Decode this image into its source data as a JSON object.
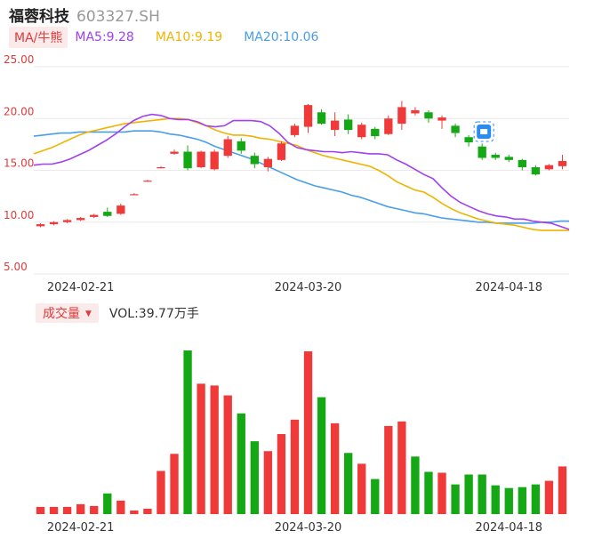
{
  "header": {
    "stock_name": "福蓉科技",
    "stock_code": "603327.SH"
  },
  "ma_bar": {
    "toggle_label": "MA/牛熊",
    "ma5_label": "MA5:9.28",
    "ma10_label": "MA10:9.19",
    "ma20_label": "MA20:10.06",
    "ma5_color": "#a040f0",
    "ma10_color": "#f0b400",
    "ma20_color": "#4a9ee8"
  },
  "volume_bar": {
    "toggle_label": "成交量",
    "value_label": "VOL:39.77万手"
  },
  "colors": {
    "up": "#f03a3a",
    "down": "#14a814",
    "axis_text": "#e03a3a",
    "grid": "#e9e9e9"
  },
  "chart_data": [
    {
      "type": "candlestick",
      "ylim": [
        5,
        25
      ],
      "y_ticks": [
        "25.00",
        "20.00",
        "15.00",
        "10.00",
        "5.00"
      ],
      "y_tick_values": [
        25,
        20,
        15,
        10,
        5
      ],
      "x_tick_labels": [
        "2024-02-21",
        "2024-03-20",
        "2024-04-18"
      ],
      "x_tick_indices": [
        3,
        20,
        35
      ],
      "candles": [
        {
          "o": 9.6,
          "c": 9.8,
          "h": 9.9,
          "l": 9.5
        },
        {
          "o": 9.8,
          "c": 10.0,
          "h": 10.1,
          "l": 9.7
        },
        {
          "o": 10.0,
          "c": 10.2,
          "h": 10.3,
          "l": 9.9
        },
        {
          "o": 10.2,
          "c": 10.4,
          "h": 10.5,
          "l": 10.1
        },
        {
          "o": 10.5,
          "c": 10.7,
          "h": 10.8,
          "l": 10.4
        },
        {
          "o": 11.0,
          "c": 10.6,
          "h": 11.4,
          "l": 10.5
        },
        {
          "o": 10.8,
          "c": 11.6,
          "h": 11.8,
          "l": 10.7
        },
        {
          "o": 12.6,
          "c": 12.7,
          "h": 12.8,
          "l": 12.6
        },
        {
          "o": 13.9,
          "c": 14.0,
          "h": 14.1,
          "l": 13.9
        },
        {
          "o": 15.2,
          "c": 15.3,
          "h": 15.4,
          "l": 15.2
        },
        {
          "o": 16.6,
          "c": 16.8,
          "h": 17.0,
          "l": 16.5
        },
        {
          "o": 16.8,
          "c": 15.2,
          "h": 17.4,
          "l": 15.0
        },
        {
          "o": 15.3,
          "c": 16.8,
          "h": 16.9,
          "l": 15.2
        },
        {
          "o": 15.1,
          "c": 16.8,
          "h": 17.0,
          "l": 15.0
        },
        {
          "o": 16.4,
          "c": 18.0,
          "h": 18.3,
          "l": 16.2
        },
        {
          "o": 17.8,
          "c": 16.9,
          "h": 18.1,
          "l": 16.6
        },
        {
          "o": 16.4,
          "c": 15.6,
          "h": 16.7,
          "l": 15.2
        },
        {
          "o": 15.3,
          "c": 16.1,
          "h": 16.3,
          "l": 14.9
        },
        {
          "o": 16.0,
          "c": 17.6,
          "h": 17.8,
          "l": 15.9
        },
        {
          "o": 18.4,
          "c": 19.3,
          "h": 19.5,
          "l": 18.2
        },
        {
          "o": 19.2,
          "c": 21.3,
          "h": 21.4,
          "l": 18.6
        },
        {
          "o": 20.6,
          "c": 19.5,
          "h": 20.9,
          "l": 19.4
        },
        {
          "o": 18.9,
          "c": 19.8,
          "h": 20.6,
          "l": 18.3
        },
        {
          "o": 19.9,
          "c": 18.9,
          "h": 20.4,
          "l": 18.5
        },
        {
          "o": 18.2,
          "c": 19.4,
          "h": 19.6,
          "l": 18.0
        },
        {
          "o": 19.0,
          "c": 18.3,
          "h": 19.2,
          "l": 18.0
        },
        {
          "o": 18.5,
          "c": 20.0,
          "h": 20.3,
          "l": 18.4
        },
        {
          "o": 19.5,
          "c": 21.1,
          "h": 21.7,
          "l": 18.9
        },
        {
          "o": 20.5,
          "c": 20.8,
          "h": 21.1,
          "l": 20.3
        },
        {
          "o": 20.6,
          "c": 20.0,
          "h": 20.8,
          "l": 19.6
        },
        {
          "o": 19.8,
          "c": 20.1,
          "h": 20.3,
          "l": 19.0
        },
        {
          "o": 19.3,
          "c": 18.6,
          "h": 19.5,
          "l": 18.2
        },
        {
          "o": 18.2,
          "c": 17.7,
          "h": 18.4,
          "l": 17.3
        },
        {
          "o": 17.3,
          "c": 16.2,
          "h": 17.6,
          "l": 16.0
        },
        {
          "o": 16.5,
          "c": 16.2,
          "h": 16.7,
          "l": 16.0
        },
        {
          "o": 16.3,
          "c": 16.0,
          "h": 16.5,
          "l": 15.8
        },
        {
          "o": 16.0,
          "c": 15.3,
          "h": 16.1,
          "l": 15.0
        },
        {
          "o": 15.3,
          "c": 14.6,
          "h": 15.5,
          "l": 14.5
        },
        {
          "o": 15.1,
          "c": 15.5,
          "h": 15.6,
          "l": 15.0
        },
        {
          "o": 15.4,
          "c": 15.9,
          "h": 16.5,
          "l": 15.1
        }
      ],
      "ma5": [
        15.5,
        15.6,
        15.6,
        15.8,
        16.1,
        16.5,
        16.9,
        17.4,
        17.9,
        18.5,
        19.2,
        19.8,
        20.2,
        20.4,
        20.3,
        20.0,
        19.9,
        19.9,
        19.7,
        19.3,
        19.2,
        19.3,
        19.8,
        19.8,
        19.8,
        19.7,
        19.3,
        18.6,
        17.7,
        17.2,
        17.0,
        16.9,
        16.8,
        16.8,
        16.7,
        16.8,
        16.7,
        16.6,
        16.6,
        16.5,
        16.0,
        15.6,
        15.1,
        14.6,
        14.2,
        13.3,
        12.5,
        11.9,
        11.5,
        11.1,
        10.8,
        10.6,
        10.5,
        10.3,
        10.3,
        10.1,
        10.0,
        9.9,
        9.6,
        9.3
      ],
      "ma10": [
        16.6,
        16.9,
        17.2,
        17.6,
        18.0,
        18.4,
        18.7,
        18.9,
        19.1,
        19.3,
        19.5,
        19.6,
        19.7,
        19.8,
        19.9,
        20.0,
        20.0,
        19.9,
        19.6,
        19.3,
        18.9,
        18.6,
        18.4,
        18.4,
        18.3,
        18.1,
        18.0,
        17.8,
        17.6,
        17.4,
        17.0,
        16.7,
        16.4,
        16.2,
        16.0,
        15.8,
        15.6,
        15.4,
        15.0,
        14.5,
        13.9,
        13.5,
        13.1,
        12.9,
        12.4,
        11.8,
        11.3,
        10.9,
        10.6,
        10.3,
        10.1,
        9.9,
        9.8,
        9.7,
        9.5,
        9.3,
        9.2,
        9.2,
        9.2,
        9.2
      ],
      "ma20": [
        18.3,
        18.4,
        18.5,
        18.6,
        18.6,
        18.7,
        18.7,
        18.7,
        18.7,
        18.7,
        18.7,
        18.8,
        18.8,
        18.8,
        18.7,
        18.5,
        18.4,
        18.2,
        18.0,
        17.7,
        17.3,
        17.0,
        16.7,
        16.4,
        16.1,
        15.7,
        15.3,
        14.9,
        14.5,
        14.1,
        13.8,
        13.5,
        13.3,
        13.1,
        12.9,
        12.6,
        12.4,
        12.1,
        11.8,
        11.5,
        11.3,
        11.1,
        10.9,
        10.8,
        10.6,
        10.4,
        10.3,
        10.2,
        10.1,
        10.0,
        10.0,
        9.9,
        9.9,
        9.9,
        9.9,
        9.9,
        10.0,
        10.0,
        10.1,
        10.1
      ]
    },
    {
      "type": "bar",
      "series_name": "成交量",
      "x_tick_labels": [
        "2024-02-21",
        "2024-03-20",
        "2024-04-18"
      ],
      "x_tick_indices": [
        3,
        20,
        35
      ],
      "values": [
        8,
        8,
        8,
        11,
        9,
        23,
        15,
        4,
        6,
        48,
        67,
        182,
        145,
        143,
        132,
        112,
        81,
        70,
        89,
        105,
        181,
        130,
        101,
        68,
        56,
        39,
        98,
        103,
        64,
        47,
        46,
        33,
        44,
        44,
        32,
        29,
        30,
        33,
        37,
        53
      ],
      "up_flags": [
        1,
        1,
        1,
        1,
        1,
        0,
        1,
        1,
        1,
        1,
        1,
        0,
        1,
        1,
        1,
        0,
        0,
        1,
        1,
        1,
        1,
        0,
        1,
        0,
        1,
        0,
        1,
        1,
        0,
        0,
        1,
        0,
        0,
        0,
        0,
        0,
        0,
        0,
        1,
        1
      ]
    }
  ]
}
